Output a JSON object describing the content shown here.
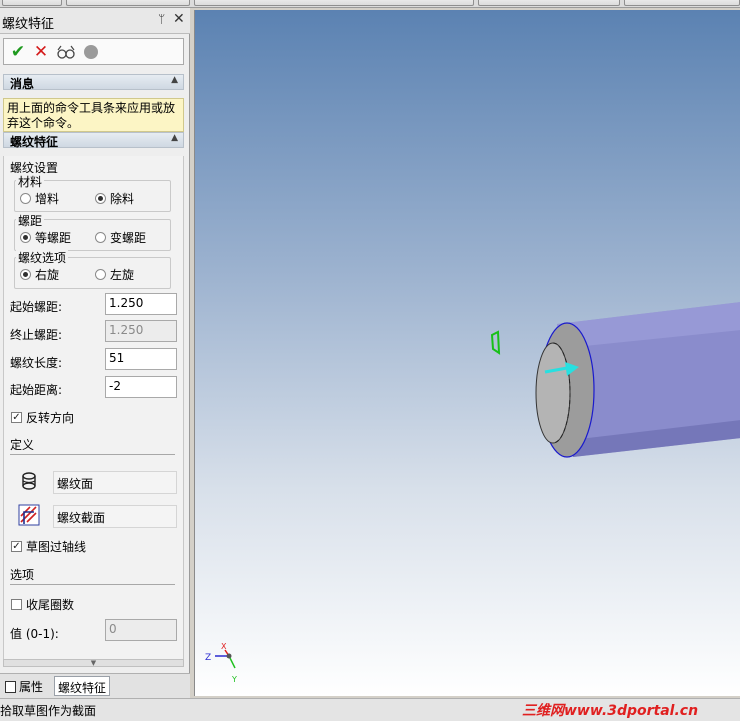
{
  "panel": {
    "title": "螺纹特征",
    "pin_icon": "pin-icon",
    "close_icon": "close-icon"
  },
  "commands": {
    "ok": "✔",
    "cancel": "✕",
    "preview": "6ɔ",
    "ok_icon": "check-icon",
    "cancel_icon": "x-icon",
    "preview_icon": "glasses-icon"
  },
  "message": {
    "header": "消息",
    "line1": "用上面的命令工具条来应用或放",
    "line2": "弃这个命令。"
  },
  "thread": {
    "header": "螺纹特征",
    "settings_label": "螺纹设置",
    "material": {
      "label": "材料",
      "add": "增料",
      "remove": "除料",
      "selected": "除料"
    },
    "pitch": {
      "label": "螺距",
      "equal": "等螺距",
      "variable": "变螺距",
      "selected": "等螺距"
    },
    "options": {
      "label": "螺纹选项",
      "right": "右旋",
      "left": "左旋",
      "selected": "右旋"
    },
    "start_pitch": {
      "label": "起始螺距:",
      "value": "1.250"
    },
    "end_pitch": {
      "label": "终止螺距:",
      "value": "1.250"
    },
    "length": {
      "label": "螺纹长度:",
      "value": "51"
    },
    "start_distance": {
      "label": "起始距离:",
      "value": "-2"
    },
    "reverse": {
      "label": "反转方向",
      "checked": true
    },
    "definition_label": "定义",
    "surface": "螺纹面",
    "section": "螺纹截面",
    "sketch_axis": {
      "label": "草图过轴线",
      "checked": true
    },
    "options_label": "选项",
    "tail_turns": {
      "label": "收尾圈数",
      "checked": false
    },
    "value": {
      "label": "值 (0-1):",
      "value": "0"
    }
  },
  "tabs": {
    "properties": "属性",
    "thread": "螺纹特征"
  },
  "status": {
    "text": "拾取草图作为截面"
  },
  "watermark": "三维网www.3dportal.cn",
  "triad": {
    "z": "Z",
    "x": "X",
    "y": "Y"
  },
  "colors": {
    "cylinder": "#8a8ccc",
    "cylinder_dark": "#6c6eb0",
    "face": "#a9a9a9",
    "arrow": "#27e0e0",
    "edge": "#1a1acc",
    "marker": "#18c018"
  }
}
